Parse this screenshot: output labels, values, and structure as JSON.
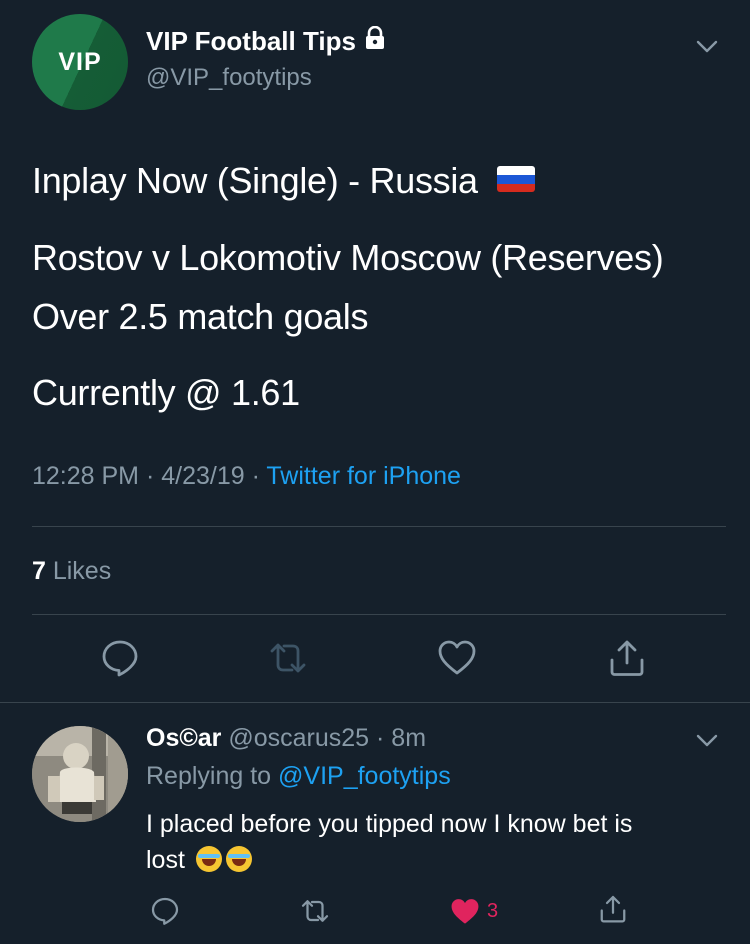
{
  "tweet": {
    "avatar_text": "VIP",
    "display_name": "VIP Football Tips",
    "handle": "@VIP_footytips",
    "lines": [
      "Inplay Now (Single) - Russia",
      "Rostov v Lokomotiv Moscow (Reserves)",
      "Over 2.5 match goals",
      "Currently @ 1.61"
    ],
    "time": "12:28 PM · 4/23/19 · ",
    "source": "Twitter for iPhone",
    "likes_count": "7",
    "likes_label": " Likes"
  },
  "reply": {
    "display_name": "Os©ar",
    "handle_time": " @oscarus25 · 8m",
    "replying_label": "Replying to ",
    "replying_handle": "@VIP_footytips",
    "text_line1": "I placed before you tipped now I know bet is",
    "text_line2": "lost",
    "like_count": "3"
  },
  "icons": {
    "lock": "lock-icon",
    "chevron": "chevron-down-icon",
    "reply": "reply-icon",
    "retweet": "retweet-icon",
    "like": "heart-icon",
    "share": "share-icon",
    "flag": "russia-flag",
    "emoji": "tears-of-joy-emoji"
  },
  "colors": {
    "background": "#15202b",
    "secondary_text": "#8899a6",
    "link": "#1da1f2",
    "like_active": "#e0245e",
    "avatar_green": "#1f7a4a"
  }
}
